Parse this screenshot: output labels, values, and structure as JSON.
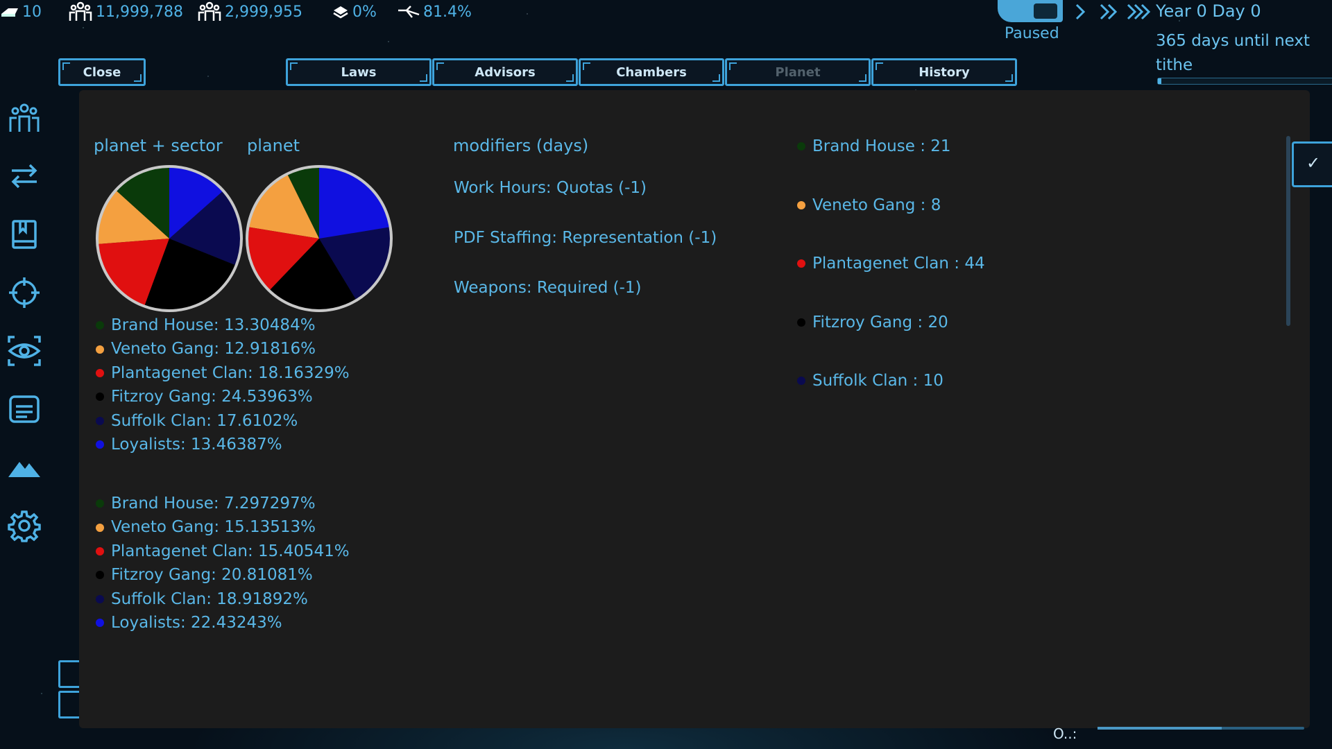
{
  "topbar": {
    "credits": "10",
    "population": "11,999,788",
    "workforce": "2,999,955",
    "stat_3": "0%",
    "stat_4": "81.4%"
  },
  "time": {
    "status": "Paused",
    "date": "Year 0 Day 0",
    "tithe_text": "365 days until next tithe",
    "tithe_progress": 0.02
  },
  "tabs": {
    "close": "Close",
    "items": [
      {
        "label": "Laws"
      },
      {
        "label": "Advisors"
      },
      {
        "label": "Chambers"
      },
      {
        "label": "Planet"
      },
      {
        "label": "History"
      }
    ],
    "active": "Planet"
  },
  "sidebar_icons": [
    "population-icon",
    "trade-icon",
    "laws-book-icon",
    "target-icon",
    "surveillance-eye-icon",
    "document-icon",
    "terrain-icon",
    "settings-gear-icon"
  ],
  "panel": {
    "label_planet_sector": "planet + sector",
    "label_planet": "planet",
    "modifiers_header": "modifiers (days)",
    "check": "✓",
    "bottom_fragment": "O..:"
  },
  "factions": [
    {
      "name": "Brand House",
      "color": "#0a3a0a"
    },
    {
      "name": "Veneto Gang",
      "color": "#f4a040"
    },
    {
      "name": "Plantagenet Clan",
      "color": "#e01010"
    },
    {
      "name": "Fitzroy Gang",
      "color": "#000000"
    },
    {
      "name": "Suffolk Clan",
      "color": "#0a0a50"
    },
    {
      "name": "Loyalists",
      "color": "#1010e0"
    }
  ],
  "chart_data": [
    {
      "type": "pie",
      "title": "planet + sector",
      "series": [
        {
          "name": "Brand House",
          "value": 13.30484,
          "label": "Brand House: 13.30484%",
          "color": "#0a3a0a"
        },
        {
          "name": "Veneto Gang",
          "value": 12.91816,
          "label": "Veneto Gang: 12.91816%",
          "color": "#f4a040"
        },
        {
          "name": "Plantagenet Clan",
          "value": 18.16329,
          "label": "Plantagenet Clan: 18.16329%",
          "color": "#e01010"
        },
        {
          "name": "Fitzroy Gang",
          "value": 24.53963,
          "label": "Fitzroy Gang: 24.53963%",
          "color": "#000000"
        },
        {
          "name": "Suffolk Clan",
          "value": 17.6102,
          "label": "Suffolk Clan: 17.6102%",
          "color": "#0a0a50"
        },
        {
          "name": "Loyalists",
          "value": 13.46387,
          "label": "Loyalists: 13.46387%",
          "color": "#1010e0"
        }
      ]
    },
    {
      "type": "pie",
      "title": "planet",
      "series": [
        {
          "name": "Brand House",
          "value": 7.297297,
          "label": "Brand House: 7.297297%",
          "color": "#0a3a0a"
        },
        {
          "name": "Veneto Gang",
          "value": 15.13513,
          "label": "Veneto Gang: 15.13513%",
          "color": "#f4a040"
        },
        {
          "name": "Plantagenet Clan",
          "value": 15.40541,
          "label": "Plantagenet Clan: 15.40541%",
          "color": "#e01010"
        },
        {
          "name": "Fitzroy Gang",
          "value": 20.81081,
          "label": "Fitzroy Gang: 20.81081%",
          "color": "#000000"
        },
        {
          "name": "Suffolk Clan",
          "value": 18.91892,
          "label": "Suffolk Clan: 18.91892%",
          "color": "#0a0a50"
        },
        {
          "name": "Loyalists",
          "value": 22.43243,
          "label": "Loyalists: 22.43243%",
          "color": "#1010e0"
        }
      ]
    }
  ],
  "modifiers": [
    "Work Hours: Quotas (-1)",
    "PDF Staffing: Representation (-1)",
    "Weapons: Required (-1)"
  ],
  "faction_days": [
    {
      "label": "Brand House : 21",
      "color": "#0a3a0a"
    },
    {
      "label": "Veneto Gang : 8",
      "color": "#f4a040"
    },
    {
      "label": "Plantagenet Clan : 44",
      "color": "#e01010"
    },
    {
      "label": "Fitzroy Gang : 20",
      "color": "#000000"
    },
    {
      "label": "Suffolk Clan : 10",
      "color": "#0a0a50"
    }
  ]
}
